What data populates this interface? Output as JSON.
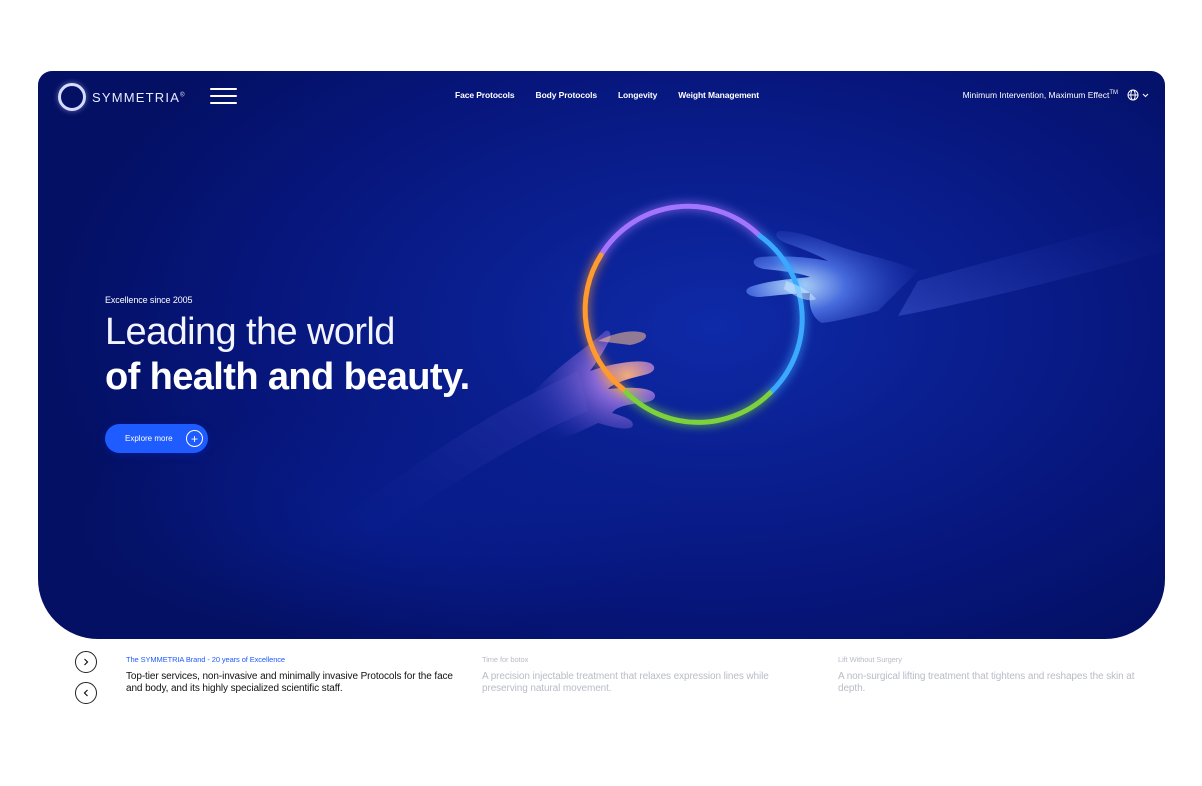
{
  "brand": {
    "name": "SYMMETRIA",
    "trademark": "®"
  },
  "nav": {
    "items": [
      "Face Protocols",
      "Body Protocols",
      "Longevity",
      "Weight Management"
    ],
    "tagline": "Minimum Intervention, Maximum Effect",
    "tagline_mark": "TM",
    "language_icon": "globe-icon"
  },
  "hero": {
    "eyebrow": "Excellence since 2005",
    "headline_light": "Leading the world",
    "headline_bold": "of health and beauty.",
    "cta_label": "Explore more",
    "cta_icon": "plus-icon",
    "ring_colors": [
      "#a374ff",
      "#3aa9ff",
      "#7bd13c",
      "#ff9a2e"
    ]
  },
  "slides": [
    {
      "kicker": "The SYMMETRIA Brand - 20 years of Excellence",
      "text": "Top-tier services, non-invasive and minimally invasive Protocols for the face and body, and its highly specialized scientific staff.",
      "active": true
    },
    {
      "kicker": "Time for botox",
      "text": "A precision injectable treatment that relaxes expression lines while preserving natural movement.",
      "active": false
    },
    {
      "kicker": "Lift Without Surgery",
      "text": "A non-surgical lifting treatment that tightens and reshapes the skin at depth.",
      "active": false
    }
  ],
  "colors": {
    "hero_bg": "#0a1f90",
    "accent": "#1f5cff"
  }
}
